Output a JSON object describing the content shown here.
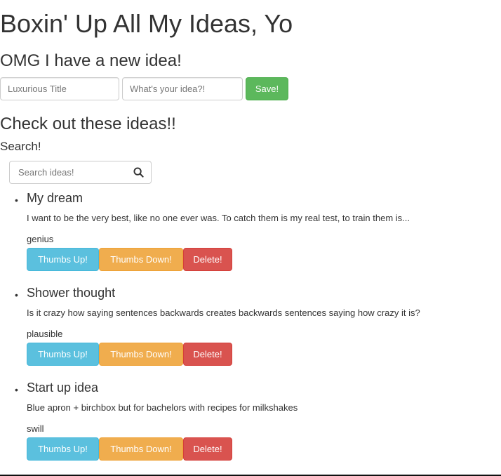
{
  "header": {
    "title": "Boxin' Up All My Ideas, Yo",
    "new_idea_heading": "OMG I have a new idea!"
  },
  "form": {
    "title_placeholder": "Luxurious Title",
    "body_placeholder": "What's your idea?!",
    "title_value": "",
    "body_value": "",
    "save_label": "Save!"
  },
  "list": {
    "heading": "Check out these ideas!!",
    "search_label": "Search!",
    "search_placeholder": "Search ideas!",
    "search_value": "",
    "bullet": "•"
  },
  "ideas": [
    {
      "title": "My dream",
      "body": "I want to be the very best, like no one ever was. To catch them is my real test, to train them is...",
      "quality": "genius",
      "thumbs_up_label": "Thumbs Up!",
      "thumbs_down_label": "Thumbs Down!",
      "delete_label": "Delete!"
    },
    {
      "title": "Shower thought",
      "body": "Is it crazy how saying sentences backwards creates backwards sentences saying how crazy it is?",
      "quality": "plausible",
      "thumbs_up_label": "Thumbs Up!",
      "thumbs_down_label": "Thumbs Down!",
      "delete_label": "Delete!"
    },
    {
      "title": "Start up idea",
      "body": "Blue apron + birchbox but for bachelors with recipes for milkshakes",
      "quality": "swill",
      "thumbs_up_label": "Thumbs Up!",
      "thumbs_down_label": "Thumbs Down!",
      "delete_label": "Delete!"
    }
  ],
  "colors": {
    "save": "#5cb85c",
    "thumbs_up": "#5bc0de",
    "thumbs_down": "#f0ad4e",
    "delete": "#d9534f"
  },
  "icons": {
    "search": "search-icon"
  }
}
